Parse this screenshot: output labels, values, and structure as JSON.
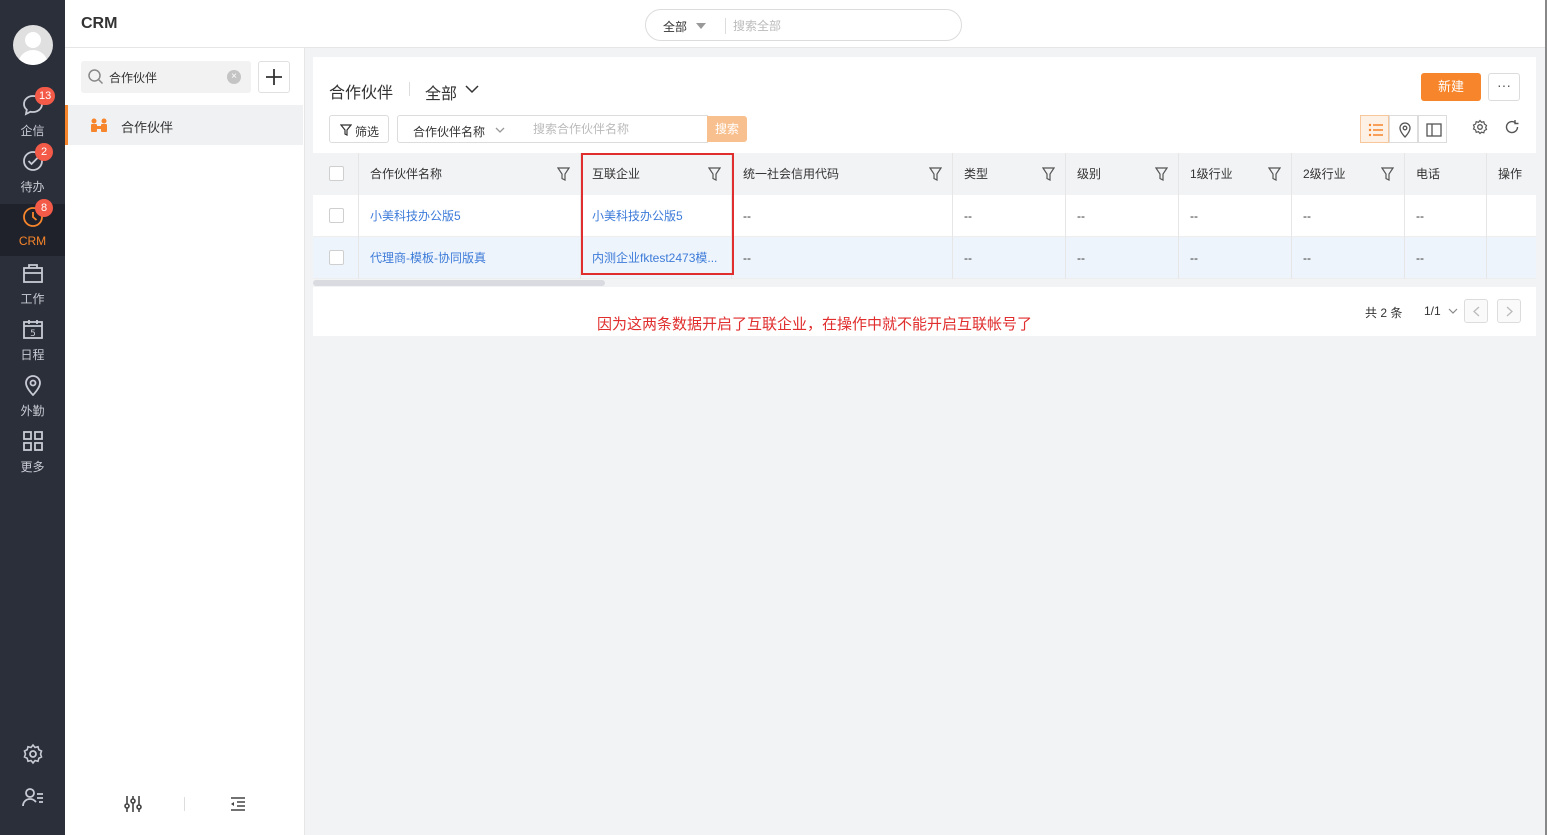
{
  "nav": {
    "items": [
      {
        "label": "企信",
        "badge": "13",
        "icon": "chat-icon"
      },
      {
        "label": "待办",
        "badge": "2",
        "icon": "todo-check-icon"
      },
      {
        "label": "CRM",
        "badge": "8",
        "icon": "crm-clock-icon",
        "active": true
      },
      {
        "label": "工作",
        "badge": "",
        "icon": "briefcase-icon"
      },
      {
        "label": "日程",
        "badge": "",
        "icon": "calendar-icon"
      },
      {
        "label": "外勤",
        "badge": "",
        "icon": "location-pin-icon"
      },
      {
        "label": "更多",
        "badge": "",
        "icon": "grid-icon"
      }
    ],
    "bottom": [
      "settings-gear-icon",
      "user-manage-icon"
    ]
  },
  "topbar": {
    "title": "CRM",
    "search_scope": "全部",
    "search_placeholder": "搜索全部"
  },
  "sidebar": {
    "search_value": "合作伙伴",
    "items": [
      {
        "label": "合作伙伴",
        "active": true
      }
    ]
  },
  "main": {
    "title": "合作伙伴",
    "scope": "全部",
    "new_button": "新建",
    "more_button": "···",
    "filter_button": "筛选",
    "search_field": "合作伙伴名称",
    "search_placeholder": "搜索合作伙伴名称",
    "search_button": "搜索",
    "columns": [
      "合作伙伴名称",
      "互联企业",
      "统一社会信用代码",
      "类型",
      "级别",
      "1级行业",
      "2级行业",
      "电话",
      "操作"
    ],
    "rows": [
      [
        "小美科技办公版5",
        "小美科技办公版5",
        "--",
        "--",
        "--",
        "--",
        "--",
        "--",
        ""
      ],
      [
        "代理商-模板-协同版真",
        "内测企业fktest2473模...",
        "--",
        "--",
        "--",
        "--",
        "--",
        "--",
        ""
      ]
    ],
    "pager": {
      "total": "共 2 条",
      "page": "1/1"
    },
    "annotation": "因为这两条数据开启了互联企业，在操作中就不能开启互联帐号了"
  },
  "colors": {
    "accent": "#f7852b",
    "nav_bg": "#2b2f3a",
    "link": "#3d7bd9",
    "annotation": "#e02d2d"
  }
}
